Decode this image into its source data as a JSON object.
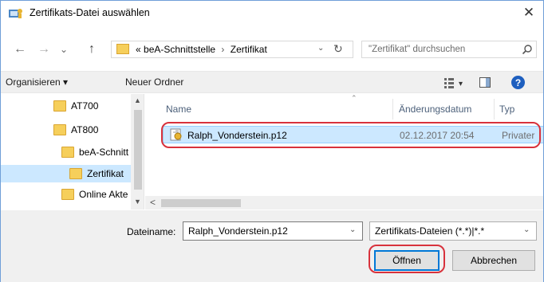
{
  "window": {
    "title": "Zertifikats-Datei auswählen",
    "close_glyph": "✕"
  },
  "nav": {
    "back_glyph": "←",
    "forward_glyph": "→",
    "recent_glyph": "⌄",
    "up_glyph": "↑",
    "path_prefix": "«",
    "path": [
      "beA-Schnittstelle",
      "Zertifikat"
    ],
    "path_separator": "›",
    "dropdown_glyph": "⌄",
    "refresh_glyph": "↻",
    "search_placeholder": "\"Zertifikat\" durchsuchen"
  },
  "toolbar": {
    "organize_label": "Organisieren ▾",
    "new_folder_label": "Neuer Ordner",
    "view_dropdown_glyph": "▾",
    "help_glyph": "?"
  },
  "tree": {
    "items": [
      {
        "label": "AT700"
      },
      {
        "label": "AT800"
      },
      {
        "label": "beA-Schnitt"
      },
      {
        "label": "Zertifikat",
        "selected": true
      },
      {
        "label": "Online Akte"
      }
    ],
    "scroll_up_glyph": "▲",
    "scroll_down_glyph": "▼"
  },
  "filelist": {
    "columns": {
      "name": "Name",
      "date": "Änderungsdatum",
      "type": "Typ"
    },
    "sort_glyph": "⌃",
    "rows": [
      {
        "name": "Ralph_Vonderstein.p12",
        "date": "02.12.2017 20:54",
        "type": "Privater"
      }
    ],
    "hscroll_left_glyph": "<"
  },
  "bottom": {
    "filename_label": "Dateiname:",
    "filename_value": "Ralph_Vonderstein.p12",
    "filename_dd_glyph": "⌄",
    "filetype_value": "Zertifikats-Dateien (*.*)|*.*",
    "filetype_dd_glyph": "⌄",
    "open_label": "Öffnen",
    "cancel_label": "Abbrechen"
  },
  "colors": {
    "accent": "#0078d7",
    "selection": "#cce8ff",
    "highlight_annotation": "#d8323c",
    "folder": "#f6cf5b"
  }
}
